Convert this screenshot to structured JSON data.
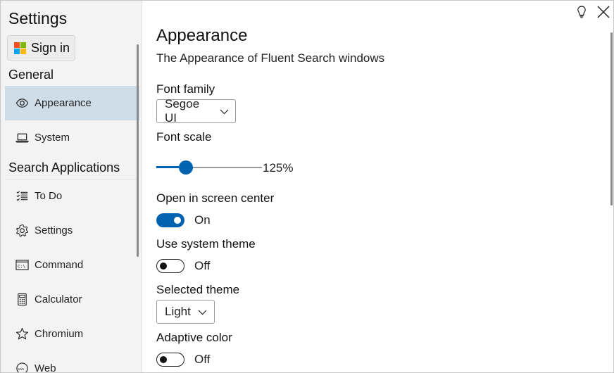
{
  "window": {
    "title": "Settings"
  },
  "sidebar": {
    "sign_in_label": "Sign in",
    "general_header": "General",
    "general_items": [
      {
        "label": "Appearance",
        "icon": "eye-icon",
        "selected": true
      },
      {
        "label": "System",
        "icon": "laptop-icon",
        "selected": false
      }
    ],
    "search_header": "Search Applications",
    "search_items": [
      {
        "label": "To Do",
        "icon": "checklist-icon"
      },
      {
        "label": "Settings",
        "icon": "gear-icon"
      },
      {
        "label": "Command",
        "icon": "command-prompt-icon"
      },
      {
        "label": "Calculator",
        "icon": "calculator-icon"
      },
      {
        "label": "Chromium",
        "icon": "star-icon"
      },
      {
        "label": "Web",
        "icon": "web-icon"
      }
    ]
  },
  "titlebar": {
    "icons": [
      "lightbulb-icon",
      "close-icon"
    ]
  },
  "main": {
    "title": "Appearance",
    "subtitle": "The Appearance of Fluent Search windows",
    "font_family": {
      "label": "Font family",
      "value": "Segoe UI"
    },
    "font_scale": {
      "label": "Font scale",
      "value_text": "125%",
      "slider_fraction": 0.28
    },
    "open_center": {
      "label": "Open in screen center",
      "state_text": "On",
      "on": true
    },
    "system_theme": {
      "label": "Use system theme",
      "state_text": "Off",
      "on": false
    },
    "selected_theme": {
      "label": "Selected theme",
      "value": "Light"
    },
    "adaptive_color": {
      "label": "Adaptive color",
      "state_text": "Off",
      "on": false
    }
  },
  "colors": {
    "accent": "#0063b1",
    "selected_nav": "#cfdde8",
    "sidebar_bg": "#f3f3f3",
    "ms_red": "#f25022",
    "ms_green": "#7fba00",
    "ms_blue": "#00a4ef",
    "ms_yellow": "#ffb900"
  }
}
